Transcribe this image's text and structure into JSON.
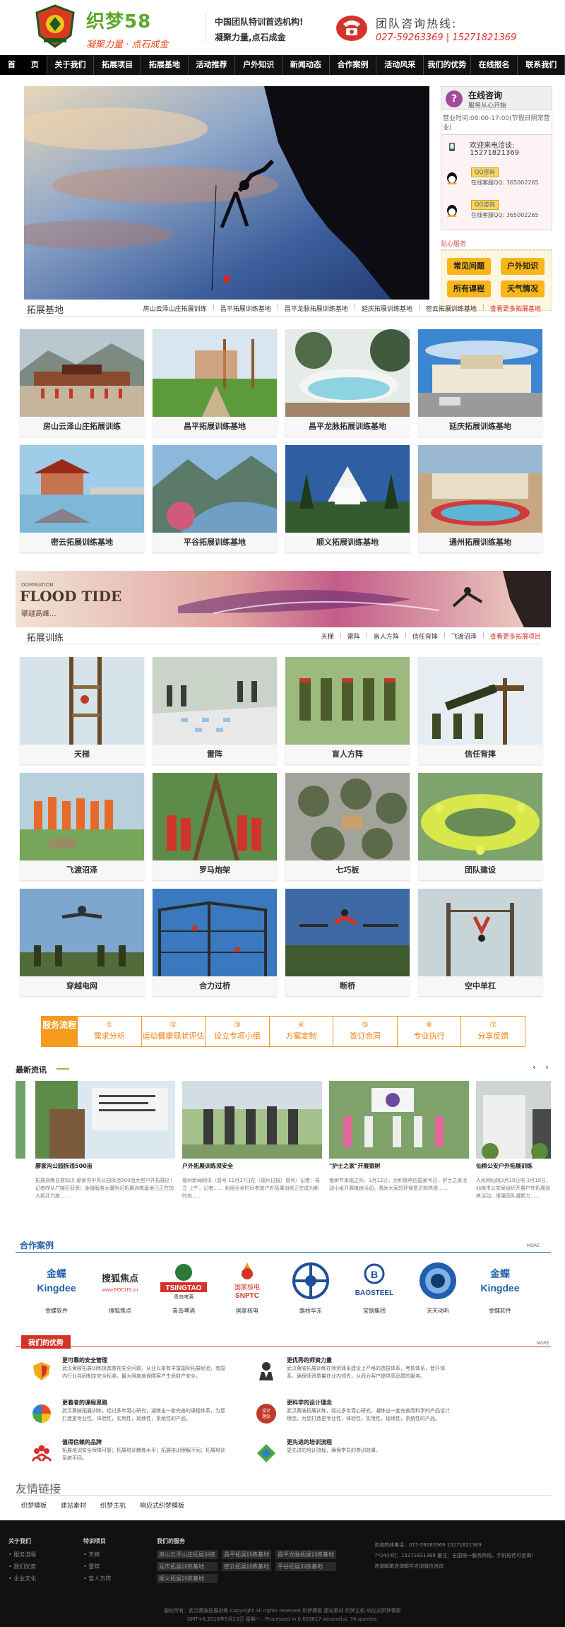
{
  "header": {
    "logo_name": "织梦58",
    "slogan": "凝聚力量 · 点石成金",
    "tagline1": "中国团队特训首选机构!",
    "tagline2": "凝聚力量,点石成金",
    "hotline_label": "团队咨询热线:",
    "hotline_numbers": "027-59263369 | 15271821369"
  },
  "nav": [
    "首　　页",
    "关于我们",
    "拓展项目",
    "拓展基地",
    "活动推荐",
    "户外知识",
    "新闻动态",
    "合作案例",
    "活动风采",
    "我们的优势",
    "在线报名",
    "联系我们"
  ],
  "sidebar": {
    "title": "在线咨询",
    "subtitle": "服务从心开始",
    "hours": "营业时间:08:00-17:00(节假日照常营业)",
    "welcome": "欢迎来电洽谈:",
    "welcome_phone": "15271821369",
    "qq_button": "QQ咨询",
    "qq_rows": [
      {
        "text": "在线客服QQ: 365002265"
      },
      {
        "text": "在线客服QQ: 365002265"
      }
    ],
    "service_title": "贴心服务",
    "service_buttons": [
      "常见问题",
      "户外知识",
      "所有课程",
      "天气情况"
    ]
  },
  "bases": {
    "title": "拓展基地",
    "links": [
      "房山云泽山庄拓展训练",
      "昌平拓展训练基地",
      "昌平龙脉拓展训练基地",
      "延庆拓展训练基地",
      "密云拓展训练基地"
    ],
    "more": "查看更多拓展基地",
    "cards": [
      "房山云泽山庄拓展训练",
      "昌平拓展训练基地",
      "昌平龙脉拓展训练基地",
      "延庆拓展训练基地",
      "密云拓展训练基地",
      "平谷拓展训练基地",
      "顺义拓展训练基地",
      "通州拓展训练基地"
    ]
  },
  "flood": {
    "small": "DOMINATION",
    "big": "FLOOD TIDE",
    "cn": "攀越高峰..."
  },
  "training": {
    "title": "拓展训练",
    "links": [
      "天梯",
      "雷阵",
      "盲人方阵",
      "信任背摔",
      "飞渡沼泽"
    ],
    "more": "查看更多拓展项目",
    "cards": [
      "天梯",
      "雷阵",
      "盲人方阵",
      "信任背摔",
      "飞渡沼泽",
      "罗马炮架",
      "七巧板",
      "团队建设",
      "穿越电网",
      "合力过桥",
      "断桥",
      "空中单杠"
    ]
  },
  "flow": {
    "head": "服务流程",
    "steps": [
      {
        "n": "①",
        "t": "需求分析"
      },
      {
        "n": "②",
        "t": "运动健康现状评估"
      },
      {
        "n": "③",
        "t": "设立专项小组"
      },
      {
        "n": "④",
        "t": "方案定制"
      },
      {
        "n": "⑤",
        "t": "签订合同"
      },
      {
        "n": "⑥",
        "t": "专业执行"
      },
      {
        "n": "⑦",
        "t": "分享反馈"
      }
    ]
  },
  "news": {
    "title": "最新资讯",
    "prev": "‹",
    "next": "›",
    "items": [
      {
        "title": "廖家沟公园拆违500亩",
        "summary": "拓展训练自救知识 廖家沟中央公园拆违500亩大型户外拓展区！记者昨从广陵区获悉：金融服务大厦附近拓展训练基地已正在加大拆迁力度……"
      },
      {
        "title": "户外拓展训练须安全",
        "summary": "福州新闻网讯（冒号 11月17日在（福州日报）冒号）记者：易立 上午，记者…… 利用业余时间参加户外拓展训练正在成为新时尚……"
      },
      {
        "title": "\"护士之家\"开展银树",
        "summary": "银树节来临之际，3月12日，为积极响应国家号召，护士之家活动小组开展植树活动，激发大家的环保意识和热情……"
      },
      {
        "title": "仙桃公安户外拓展训练",
        "summary": "人民网仙桃3月19日电 3月19日，仙桃市公安局组织开展户外拓展训练活动，增强团队凝聚力……"
      }
    ]
  },
  "partners": {
    "title": "合作案例",
    "more": "MORE",
    "items": [
      "金蝶软件",
      "搜狐焦点",
      "青岛啤酒",
      "国家核电",
      "路桥华东",
      "宝钢集团",
      "天天动听",
      "金蝶软件"
    ]
  },
  "advantages": {
    "title": "我们的优势",
    "more": "MORE",
    "items": [
      {
        "h": "更可靠的安全管理",
        "d": "武汉黄陂拓展训练极其重视安全问题，从业以来有丰富国际拓展经验，有国内行业共同制定安全标准，最大限度地保障客户生命财产安全。"
      },
      {
        "h": "更优秀的师资力量",
        "d": "武汉黄陂拓展训练在师资体系建设上严格的选拔体系，考核体系，晋升体系，确保师资质量在业内领先，从而为客户提供高品质的服务。"
      },
      {
        "h": "更着者的课程思路",
        "d": "武汉黄陂拓展训练，经过多年潜心研究，凝练出一套完善的课程体系，为您打造更专业性，体验性，实用性，延续性，系统性的产品。"
      },
      {
        "h": "更科学的设计理念",
        "d": "武汉黄陂拓展训练，经过多年潜心研究，凝练出一套完善而科学的产品设计理念，为您打造更专业性，体验性，实用性，延续性，系统性的产品。"
      },
      {
        "h": "值得信赖的品牌",
        "d": "拓展培训安全保障可靠；拓展培训教练水平；拓展培训理解不同；拓展培训系统不同。"
      },
      {
        "h": "更先进的培训流程",
        "d": "更先进的培训流程，确保学员的参训效果。"
      }
    ]
  },
  "friend_links": {
    "title": "友情链接",
    "items": [
      "织梦模板",
      "建站素材",
      "织梦主机",
      "响应式织梦模板"
    ]
  },
  "footer": {
    "col1_title": "关于我们",
    "col1": [
      "服务流程",
      "我们优势",
      "企业文化"
    ],
    "col2_title": "特训项目",
    "col2": [
      "天梯",
      "雷阵",
      "盲人方阵"
    ],
    "col3_title": "我们的服务",
    "col3_tags": [
      "房山云泽山庄拓展训练",
      "昌平拓展训练基地",
      "昌平龙脉拓展训练基地",
      "延庆拓展训练基地",
      "密云拓展训练基地",
      "平谷拓展训练基地",
      "顺义拓展训练基地"
    ],
    "contact": "咨询热线电话：027-59263369 15271821369\n7*24小时：15271821369 备注：全国统一服务热线，手机短信可咨询！\n咨询邮箱咨询邮件咨询微信咨询",
    "copyright": "版权所有：武汉黄陂拓展训练 Copyright All rights reserved 织梦模板 建站素材 织梦主机 响应式织梦模板",
    "runtime": "GMT+8,2016年5月23日 星期一 , Processed in 0.629617 second(s), 74 queries."
  },
  "colors": {
    "accent": "#d4332a",
    "green": "#5aa82a",
    "orange": "#f49b1e",
    "nav_bg": "#111111"
  }
}
